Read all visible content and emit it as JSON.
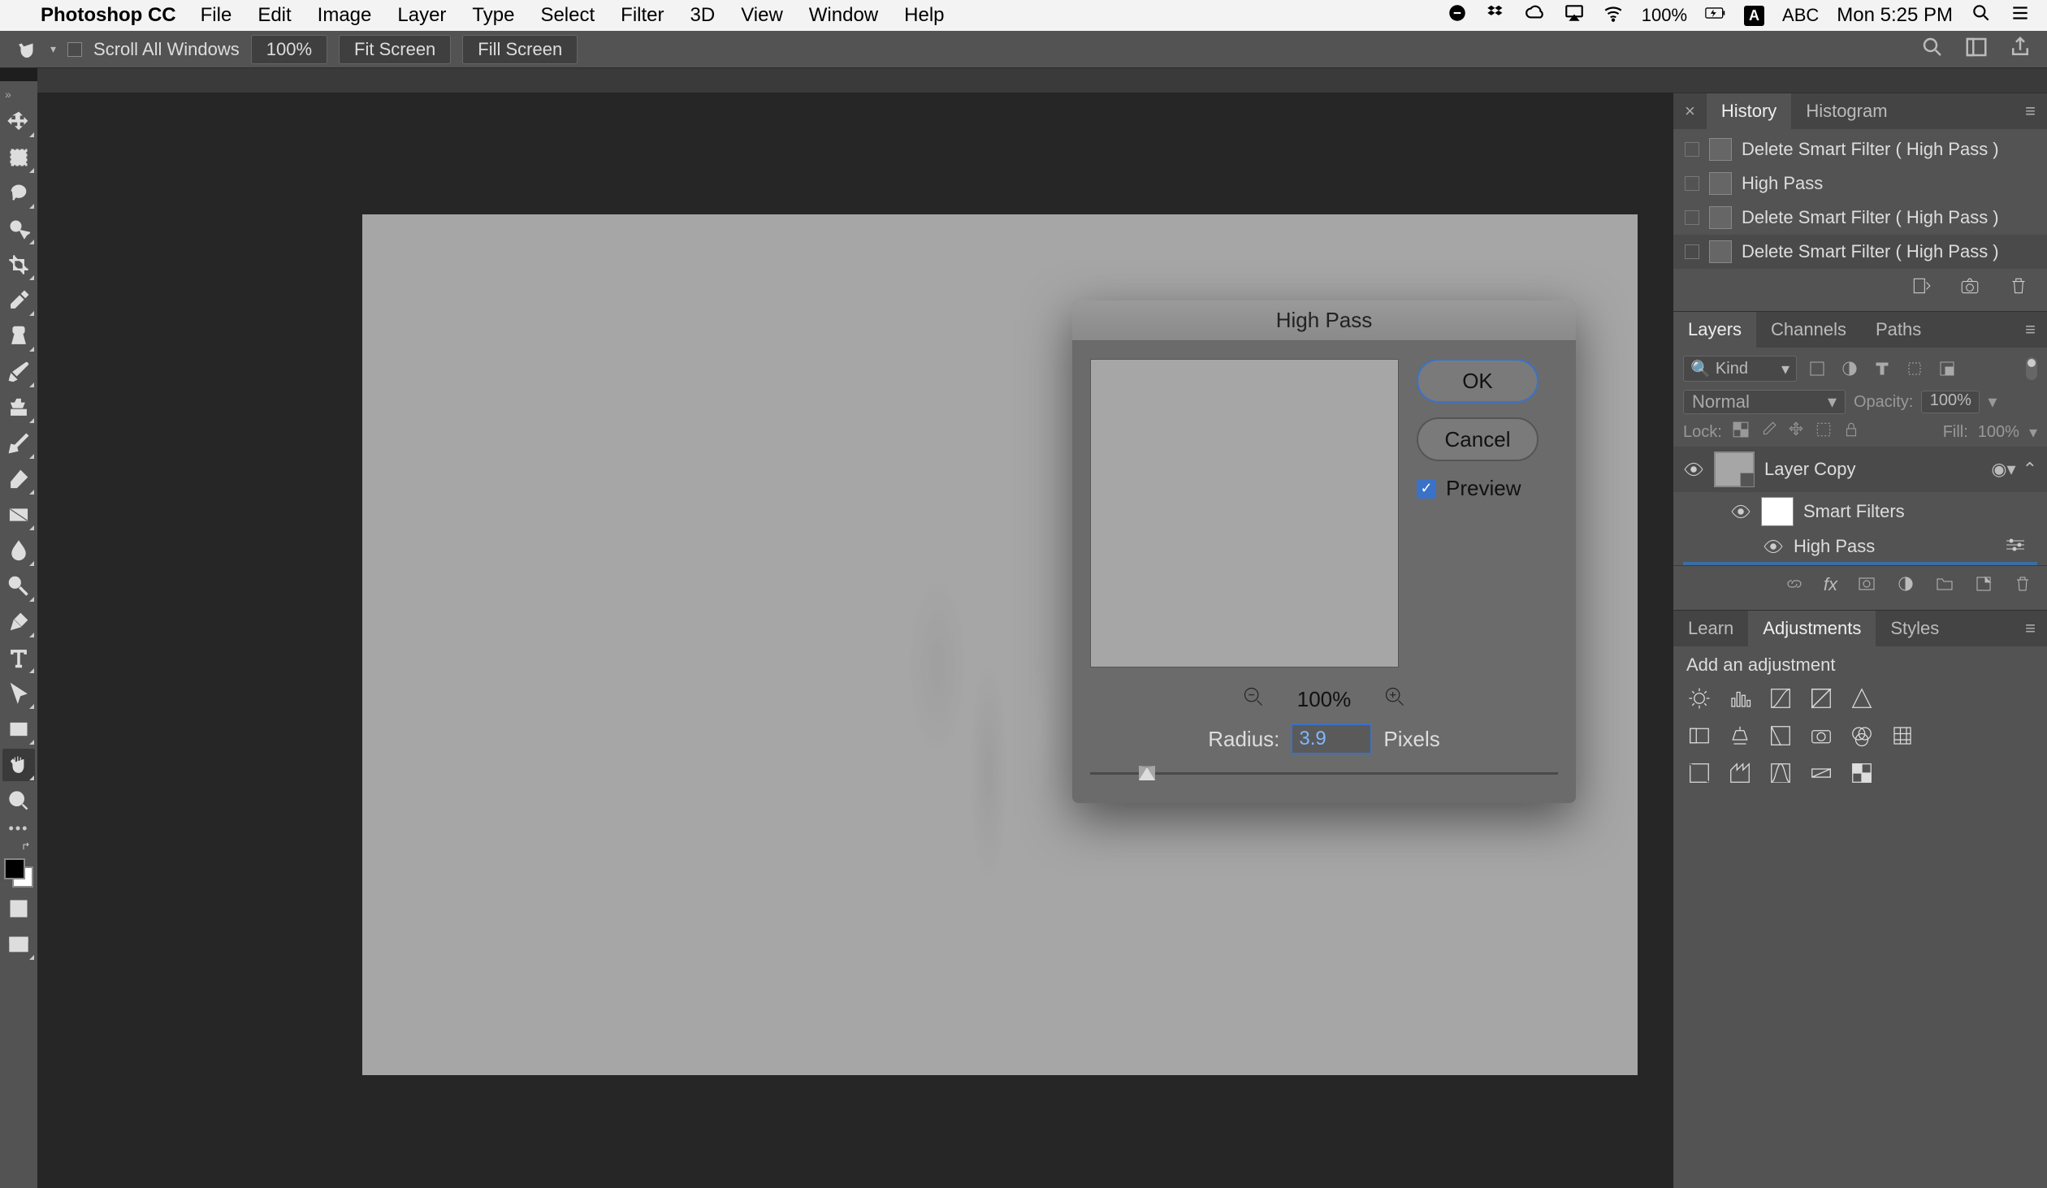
{
  "os": {
    "app_name": "Photoshop CC",
    "menus": [
      "File",
      "Edit",
      "Image",
      "Layer",
      "Type",
      "Select",
      "Filter",
      "3D",
      "View",
      "Window",
      "Help"
    ],
    "battery": "100%",
    "ime": "ABC",
    "clock": "Mon 5:25 PM"
  },
  "options_bar": {
    "scroll_all": "Scroll All Windows",
    "zoom": "100%",
    "fit": "Fit Screen",
    "fill": "Fill Screen"
  },
  "dialog": {
    "title": "High Pass",
    "ok": "OK",
    "cancel": "Cancel",
    "preview": "Preview",
    "preview_zoom": "100%",
    "radius_label": "Radius:",
    "radius_value": "3.9",
    "radius_unit": "Pixels"
  },
  "history": {
    "tab_history": "History",
    "tab_histogram": "Histogram",
    "items": [
      "Delete Smart Filter ( High Pass )",
      "High Pass",
      "Delete Smart Filter ( High Pass )",
      "Delete Smart Filter ( High Pass )"
    ]
  },
  "layers": {
    "tab_layers": "Layers",
    "tab_channels": "Channels",
    "tab_paths": "Paths",
    "kind": "Kind",
    "blend_mode": "Normal",
    "opacity_label": "Opacity:",
    "opacity": "100%",
    "lock_label": "Lock:",
    "fill_label": "Fill:",
    "fill": "100%",
    "layer_name": "Layer Copy",
    "smart_filters": "Smart Filters",
    "filter_name": "High Pass"
  },
  "adjustments": {
    "tab_learn": "Learn",
    "tab_adjustments": "Adjustments",
    "tab_styles": "Styles",
    "title": "Add an adjustment"
  }
}
